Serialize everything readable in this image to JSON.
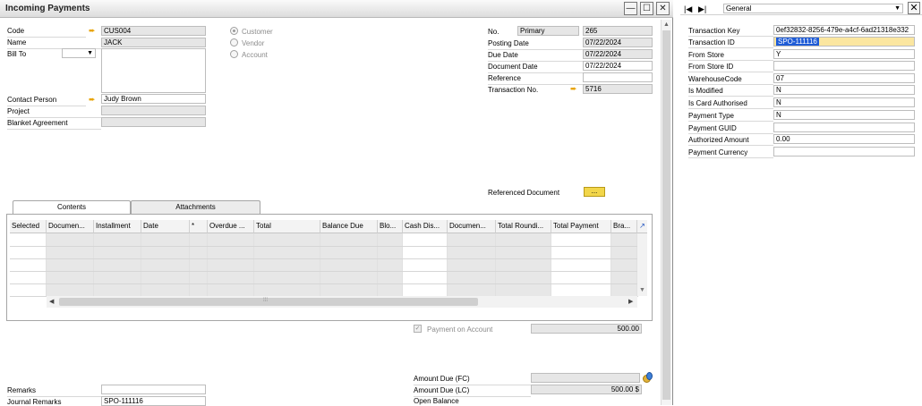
{
  "window": {
    "title": "Incoming Payments",
    "controls": {
      "minimize": "—",
      "maximize": "☐",
      "close": "✕"
    }
  },
  "header_left": {
    "code_label": "Code",
    "code_value": "CUS004",
    "name_label": "Name",
    "name_value": "JACK",
    "bill_to_label": "Bill To",
    "contact_label": "Contact Person",
    "contact_value": "Judy Brown",
    "project_label": "Project",
    "blanket_label": "Blanket Agreement"
  },
  "radios": {
    "customer": "Customer",
    "vendor": "Vendor",
    "account": "Account"
  },
  "header_right": {
    "no_label": "No.",
    "no_series": "Primary",
    "no_value": "265",
    "posting_label": "Posting Date",
    "posting_value": "07/22/2024",
    "due_label": "Due Date",
    "due_value": "07/22/2024",
    "docdate_label": "Document Date",
    "docdate_value": "07/22/2024",
    "reference_label": "Reference",
    "transno_label": "Transaction No.",
    "transno_value": "5716",
    "refdoc_label": "Referenced Document",
    "refdoc_btn": "..."
  },
  "tabs": {
    "contents": "Contents",
    "attachments": "Attachments"
  },
  "grid": {
    "columns": [
      "Selected",
      "Documen...",
      "Installment",
      "Date",
      "*",
      "Overdue ...",
      "Total",
      "Balance Due",
      "Blo...",
      "Cash Dis...",
      "Documen...",
      "Total Roundi...",
      "Total Payment",
      "Bra..."
    ]
  },
  "footer": {
    "payment_on_account_label": "Payment on Account",
    "payment_on_account_value": "500.00",
    "remarks_label": "Remarks",
    "journal_label": "Journal Remarks",
    "journal_value": "SPO-111116",
    "amount_fc_label": "Amount Due (FC)",
    "amount_lc_label": "Amount Due (LC)",
    "amount_lc_value": "500.00 $",
    "open_balance_label": "Open Balance"
  },
  "panel": {
    "nav_first": "|◀",
    "nav_next": "▶|",
    "dropdown_value": "General",
    "fields": [
      {
        "label": "Transaction Key",
        "value": "0ef32832-8256-479e-a4cf-6ad21318e332"
      },
      {
        "label": "Transaction ID",
        "value": "SPO-111116"
      },
      {
        "label": "From Store",
        "value": "Y"
      },
      {
        "label": "From Store ID",
        "value": ""
      },
      {
        "label": "WarehouseCode",
        "value": "07"
      },
      {
        "label": "Is Modified",
        "value": "N"
      },
      {
        "label": "Is Card Authorised",
        "value": "N"
      },
      {
        "label": "Payment Type",
        "value": "N"
      },
      {
        "label": "Payment GUID",
        "value": ""
      },
      {
        "label": "Authorized Amount",
        "value": "0.00"
      },
      {
        "label": "Payment Currency",
        "value": ""
      }
    ]
  }
}
